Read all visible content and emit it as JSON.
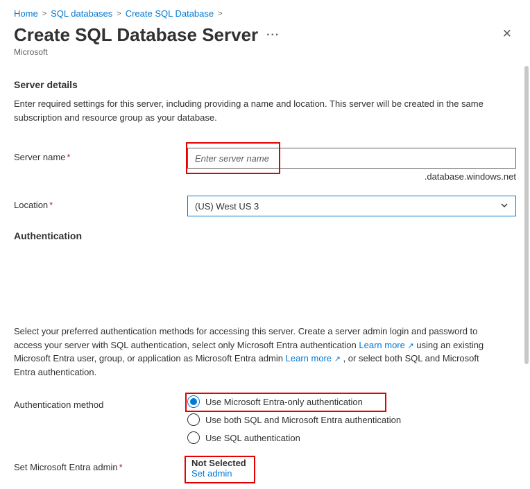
{
  "breadcrumb": {
    "items": [
      {
        "label": "Home"
      },
      {
        "label": "SQL databases"
      },
      {
        "label": "Create SQL Database"
      }
    ]
  },
  "header": {
    "title": "Create SQL Database Server",
    "subtitle": "Microsoft"
  },
  "server_details": {
    "heading": "Server details",
    "description": "Enter required settings for this server, including providing a name and location. This server will be created in the same subscription and resource group as your database."
  },
  "fields": {
    "server_name": {
      "label": "Server name",
      "placeholder": "Enter server name",
      "suffix": ".database.windows.net"
    },
    "location": {
      "label": "Location",
      "value": "(US) West US 3"
    }
  },
  "authentication": {
    "heading": "Authentication",
    "desc_part1": "Select your preferred authentication methods for accessing this server. Create a server admin login and password to access your server with SQL authentication, select only Microsoft Entra authentication ",
    "learn_more_1": "Learn more",
    "desc_part2": " using an existing Microsoft Entra user, group, or application as Microsoft Entra admin ",
    "learn_more_2": "Learn more",
    "desc_part3": " , or select both SQL and Microsoft Entra authentication.",
    "method_label": "Authentication method",
    "options": [
      {
        "label": "Use Microsoft Entra-only authentication",
        "selected": true
      },
      {
        "label": "Use both SQL and Microsoft Entra authentication",
        "selected": false
      },
      {
        "label": "Use SQL authentication",
        "selected": false
      }
    ],
    "admin": {
      "label": "Set Microsoft Entra admin",
      "value": "Not Selected",
      "link": "Set admin"
    }
  }
}
